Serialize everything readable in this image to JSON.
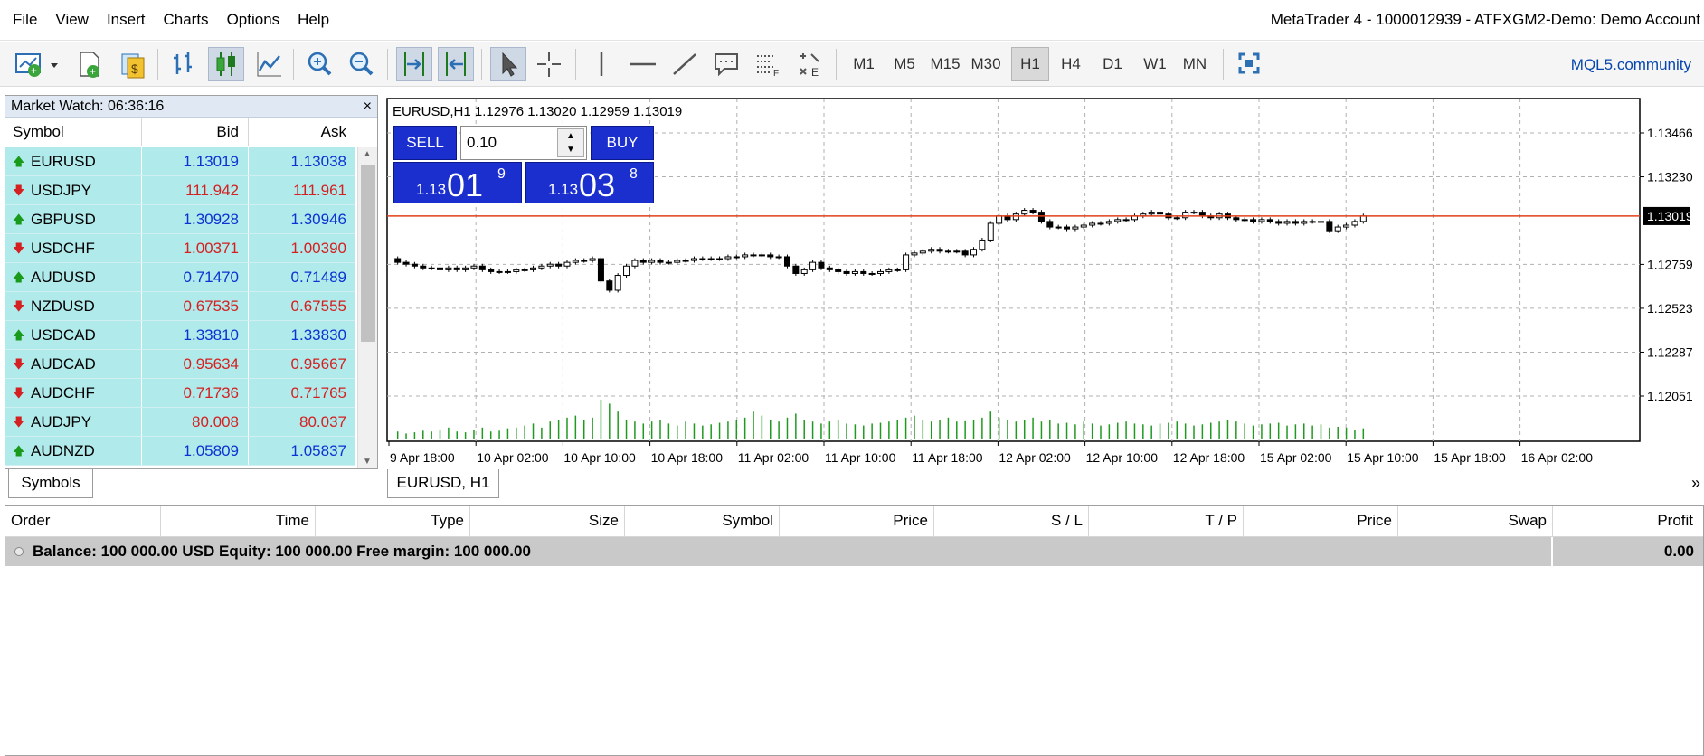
{
  "menu": {
    "items": [
      "File",
      "View",
      "Insert",
      "Charts",
      "Options",
      "Help"
    ],
    "title": "MetaTrader 4 - 1000012939 - ATFXGM2-Demo: Demo Account"
  },
  "toolbar": {
    "timeframes": [
      "M1",
      "M5",
      "M15",
      "M30",
      "H1",
      "H4",
      "D1",
      "W1",
      "MN"
    ],
    "active_timeframe": "H1",
    "community_link": "MQL5.community"
  },
  "market_watch": {
    "title": "Market Watch: 06:36:16",
    "close": "×",
    "columns": {
      "symbol": "Symbol",
      "bid": "Bid",
      "ask": "Ask"
    },
    "rows": [
      {
        "symbol": "EURUSD",
        "bid": "1.13019",
        "ask": "1.13038",
        "dir": "up"
      },
      {
        "symbol": "USDJPY",
        "bid": "111.942",
        "ask": "111.961",
        "dir": "down"
      },
      {
        "symbol": "GBPUSD",
        "bid": "1.30928",
        "ask": "1.30946",
        "dir": "up"
      },
      {
        "symbol": "USDCHF",
        "bid": "1.00371",
        "ask": "1.00390",
        "dir": "down"
      },
      {
        "symbol": "AUDUSD",
        "bid": "0.71470",
        "ask": "0.71489",
        "dir": "up"
      },
      {
        "symbol": "NZDUSD",
        "bid": "0.67535",
        "ask": "0.67555",
        "dir": "down"
      },
      {
        "symbol": "USDCAD",
        "bid": "1.33810",
        "ask": "1.33830",
        "dir": "up"
      },
      {
        "symbol": "AUDCAD",
        "bid": "0.95634",
        "ask": "0.95667",
        "dir": "down"
      },
      {
        "symbol": "AUDCHF",
        "bid": "0.71736",
        "ask": "0.71765",
        "dir": "down"
      },
      {
        "symbol": "AUDJPY",
        "bid": "80.008",
        "ask": "80.037",
        "dir": "down"
      },
      {
        "symbol": "AUDNZD",
        "bid": "1.05809",
        "ask": "1.05837",
        "dir": "up"
      }
    ],
    "tab": "Symbols"
  },
  "chart": {
    "header": "EURUSD,H1  1.12976 1.13020 1.12959 1.13019",
    "tab": "EURUSD, H1",
    "more": "»",
    "current_price": "1.13019",
    "price_levels": [
      "1.13466",
      "1.13230",
      "1.12759",
      "1.12523",
      "1.12287",
      "1.12051"
    ],
    "time_labels": [
      "9 Apr 18:00",
      "10 Apr 02:00",
      "10 Apr 10:00",
      "10 Apr 18:00",
      "11 Apr 02:00",
      "11 Apr 10:00",
      "11 Apr 18:00",
      "12 Apr 02:00",
      "12 Apr 10:00",
      "12 Apr 18:00",
      "15 Apr 02:00",
      "15 Apr 10:00",
      "15 Apr 18:00",
      "16 Apr 02:00"
    ],
    "one_click": {
      "sell": "SELL",
      "buy": "BUY",
      "lot": "0.10",
      "sell_prefix": "1.13",
      "sell_big": "01",
      "sell_sup": "9",
      "buy_prefix": "1.13",
      "buy_big": "03",
      "buy_sup": "8"
    },
    "colors": {
      "current_line": "#e0401a",
      "volume": "#1f9a1f",
      "price_badge": "#000000"
    },
    "closes": [
      1.1277,
      1.1276,
      1.1275,
      1.1274,
      1.1274,
      1.1273,
      1.1274,
      1.1273,
      1.1274,
      1.1275,
      1.1273,
      1.1272,
      1.1272,
      1.1272,
      1.1273,
      1.1273,
      1.1274,
      1.1275,
      1.1276,
      1.1275,
      1.1277,
      1.1278,
      1.1278,
      1.1279,
      1.1267,
      1.1262,
      1.127,
      1.1275,
      1.1278,
      1.1277,
      1.1278,
      1.1277,
      1.1277,
      1.1278,
      1.1278,
      1.1279,
      1.1279,
      1.1279,
      1.1279,
      1.128,
      1.128,
      1.1281,
      1.1281,
      1.1281,
      1.128,
      1.128,
      1.1275,
      1.1271,
      1.1273,
      1.1277,
      1.1274,
      1.1273,
      1.1272,
      1.1271,
      1.1272,
      1.1271,
      1.1271,
      1.1272,
      1.1273,
      1.1273,
      1.1281,
      1.1282,
      1.1283,
      1.1284,
      1.1283,
      1.1283,
      1.1283,
      1.1281,
      1.1284,
      1.1289,
      1.1298,
      1.1302,
      1.13,
      1.1303,
      1.1305,
      1.1304,
      1.1299,
      1.1296,
      1.1296,
      1.1295,
      1.1296,
      1.1297,
      1.1298,
      1.1298,
      1.1299,
      1.13,
      1.13,
      1.1302,
      1.1303,
      1.1304,
      1.1303,
      1.1301,
      1.1301,
      1.1304,
      1.1304,
      1.1302,
      1.1301,
      1.1303,
      1.1301,
      1.13,
      1.13,
      1.1299,
      1.13,
      1.1299,
      1.1298,
      1.1299,
      1.1298,
      1.1299,
      1.1299,
      1.1299,
      1.1294,
      1.1296,
      1.1297,
      1.1299,
      1.1302
    ],
    "volume_levels": [
      0.2,
      0.15,
      0.18,
      0.22,
      0.2,
      0.25,
      0.3,
      0.2,
      0.18,
      0.25,
      0.3,
      0.2,
      0.22,
      0.28,
      0.3,
      0.35,
      0.4,
      0.3,
      0.45,
      0.5,
      0.55,
      0.6,
      0.5,
      0.55,
      1.0,
      0.9,
      0.7,
      0.5,
      0.45,
      0.4,
      0.45,
      0.5,
      0.4,
      0.35,
      0.45,
      0.4,
      0.35,
      0.38,
      0.42,
      0.45,
      0.5,
      0.55,
      0.7,
      0.6,
      0.5,
      0.45,
      0.55,
      0.65,
      0.5,
      0.45,
      0.4,
      0.45,
      0.5,
      0.4,
      0.38,
      0.35,
      0.4,
      0.42,
      0.45,
      0.5,
      0.55,
      0.6,
      0.5,
      0.45,
      0.5,
      0.55,
      0.45,
      0.48,
      0.5,
      0.55,
      0.7,
      0.55,
      0.5,
      0.45,
      0.5,
      0.55,
      0.45,
      0.5,
      0.4,
      0.42,
      0.38,
      0.45,
      0.4,
      0.35,
      0.38,
      0.42,
      0.45,
      0.4,
      0.38,
      0.35,
      0.4,
      0.42,
      0.45,
      0.4,
      0.35,
      0.38,
      0.42,
      0.45,
      0.5,
      0.45,
      0.4,
      0.35,
      0.38,
      0.4,
      0.42,
      0.35,
      0.38,
      0.4,
      0.35,
      0.38,
      0.3,
      0.32,
      0.3,
      0.25,
      0.28
    ]
  },
  "terminal": {
    "columns": [
      "Order",
      "Time",
      "Type",
      "Size",
      "Symbol",
      "Price",
      "S / L",
      "T / P",
      "Price",
      "Swap",
      "Profit"
    ],
    "balance_line": "Balance: 100 000.00 USD  Equity: 100 000.00  Free margin: 100 000.00",
    "profit": "0.00"
  }
}
